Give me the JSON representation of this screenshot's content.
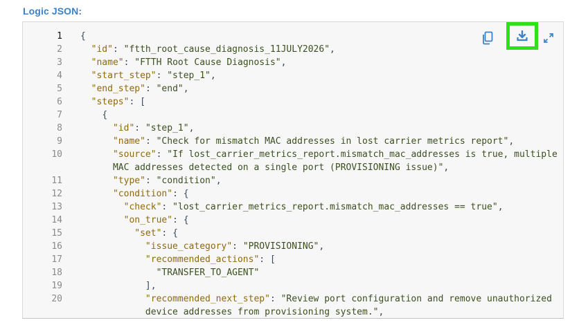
{
  "section": {
    "label": "Logic JSON:"
  },
  "toolbar": {
    "copy_icon": "copy-icon",
    "download_icon": "download-icon",
    "expand_icon": "expand-icon",
    "highlight_color": "#2fe01a",
    "icon_color": "#3b82c4"
  },
  "editor": {
    "active_line": 1,
    "lines": [
      {
        "num": "1",
        "indent": "",
        "parts": [
          [
            "p",
            "{"
          ]
        ]
      },
      {
        "num": "2",
        "indent": "  ",
        "parts": [
          [
            "k",
            "\"id\""
          ],
          [
            "p",
            ": "
          ],
          [
            "s",
            "\"ftth_root_cause_diagnosis_11JULY2026\""
          ],
          [
            "p",
            ","
          ]
        ]
      },
      {
        "num": "3",
        "indent": "  ",
        "parts": [
          [
            "k",
            "\"name\""
          ],
          [
            "p",
            ": "
          ],
          [
            "s",
            "\"FTTH Root Cause Diagnosis\""
          ],
          [
            "p",
            ","
          ]
        ]
      },
      {
        "num": "4",
        "indent": "  ",
        "parts": [
          [
            "k",
            "\"start_step\""
          ],
          [
            "p",
            ": "
          ],
          [
            "s",
            "\"step_1\""
          ],
          [
            "p",
            ","
          ]
        ]
      },
      {
        "num": "5",
        "indent": "  ",
        "parts": [
          [
            "k",
            "\"end_step\""
          ],
          [
            "p",
            ": "
          ],
          [
            "s",
            "\"end\""
          ],
          [
            "p",
            ","
          ]
        ]
      },
      {
        "num": "6",
        "indent": "  ",
        "parts": [
          [
            "k",
            "\"steps\""
          ],
          [
            "p",
            ": ["
          ]
        ]
      },
      {
        "num": "7",
        "indent": "    ",
        "parts": [
          [
            "p",
            "{"
          ]
        ]
      },
      {
        "num": "8",
        "indent": "      ",
        "parts": [
          [
            "k",
            "\"id\""
          ],
          [
            "p",
            ": "
          ],
          [
            "s",
            "\"step_1\""
          ],
          [
            "p",
            ","
          ]
        ]
      },
      {
        "num": "9",
        "indent": "      ",
        "parts": [
          [
            "k",
            "\"name\""
          ],
          [
            "p",
            ": "
          ],
          [
            "s",
            "\"Check for mismatch MAC addresses in lost carrier metrics report\""
          ],
          [
            "p",
            ","
          ]
        ]
      },
      {
        "num": "10",
        "indent": "      ",
        "parts": [
          [
            "k",
            "\"source\""
          ],
          [
            "p",
            ": "
          ],
          [
            "s",
            "\"If lost_carrier_metrics_report.mismatch_mac_addresses is true, multiple"
          ]
        ]
      },
      {
        "num": "",
        "indent": "      ",
        "parts": [
          [
            "s",
            "MAC addresses detected on a single port (PROVISIONING issue)\""
          ],
          [
            "p",
            ","
          ]
        ]
      },
      {
        "num": "11",
        "indent": "      ",
        "parts": [
          [
            "k",
            "\"type\""
          ],
          [
            "p",
            ": "
          ],
          [
            "s",
            "\"condition\""
          ],
          [
            "p",
            ","
          ]
        ]
      },
      {
        "num": "12",
        "indent": "      ",
        "parts": [
          [
            "k",
            "\"condition\""
          ],
          [
            "p",
            ": {"
          ]
        ]
      },
      {
        "num": "13",
        "indent": "        ",
        "parts": [
          [
            "k",
            "\"check\""
          ],
          [
            "p",
            ": "
          ],
          [
            "s",
            "\"lost_carrier_metrics_report.mismatch_mac_addresses == true\""
          ],
          [
            "p",
            ","
          ]
        ]
      },
      {
        "num": "14",
        "indent": "        ",
        "parts": [
          [
            "k",
            "\"on_true\""
          ],
          [
            "p",
            ": {"
          ]
        ]
      },
      {
        "num": "15",
        "indent": "          ",
        "parts": [
          [
            "k",
            "\"set\""
          ],
          [
            "p",
            ": {"
          ]
        ]
      },
      {
        "num": "16",
        "indent": "            ",
        "parts": [
          [
            "k",
            "\"issue_category\""
          ],
          [
            "p",
            ": "
          ],
          [
            "s",
            "\"PROVISIONING\""
          ],
          [
            "p",
            ","
          ]
        ]
      },
      {
        "num": "17",
        "indent": "            ",
        "parts": [
          [
            "k",
            "\"recommended_actions\""
          ],
          [
            "p",
            ": ["
          ]
        ]
      },
      {
        "num": "18",
        "indent": "              ",
        "parts": [
          [
            "s",
            "\"TRANSFER_TO_AGENT\""
          ]
        ]
      },
      {
        "num": "19",
        "indent": "            ",
        "parts": [
          [
            "p",
            "],"
          ]
        ]
      },
      {
        "num": "20",
        "indent": "            ",
        "parts": [
          [
            "k",
            "\"recommended_next_step\""
          ],
          [
            "p",
            ": "
          ],
          [
            "s",
            "\"Review port configuration and remove unauthorized"
          ]
        ]
      },
      {
        "num": "",
        "indent": "            ",
        "parts": [
          [
            "s",
            "device addresses from provisioning system.\""
          ],
          [
            "p",
            ","
          ]
        ]
      }
    ]
  }
}
